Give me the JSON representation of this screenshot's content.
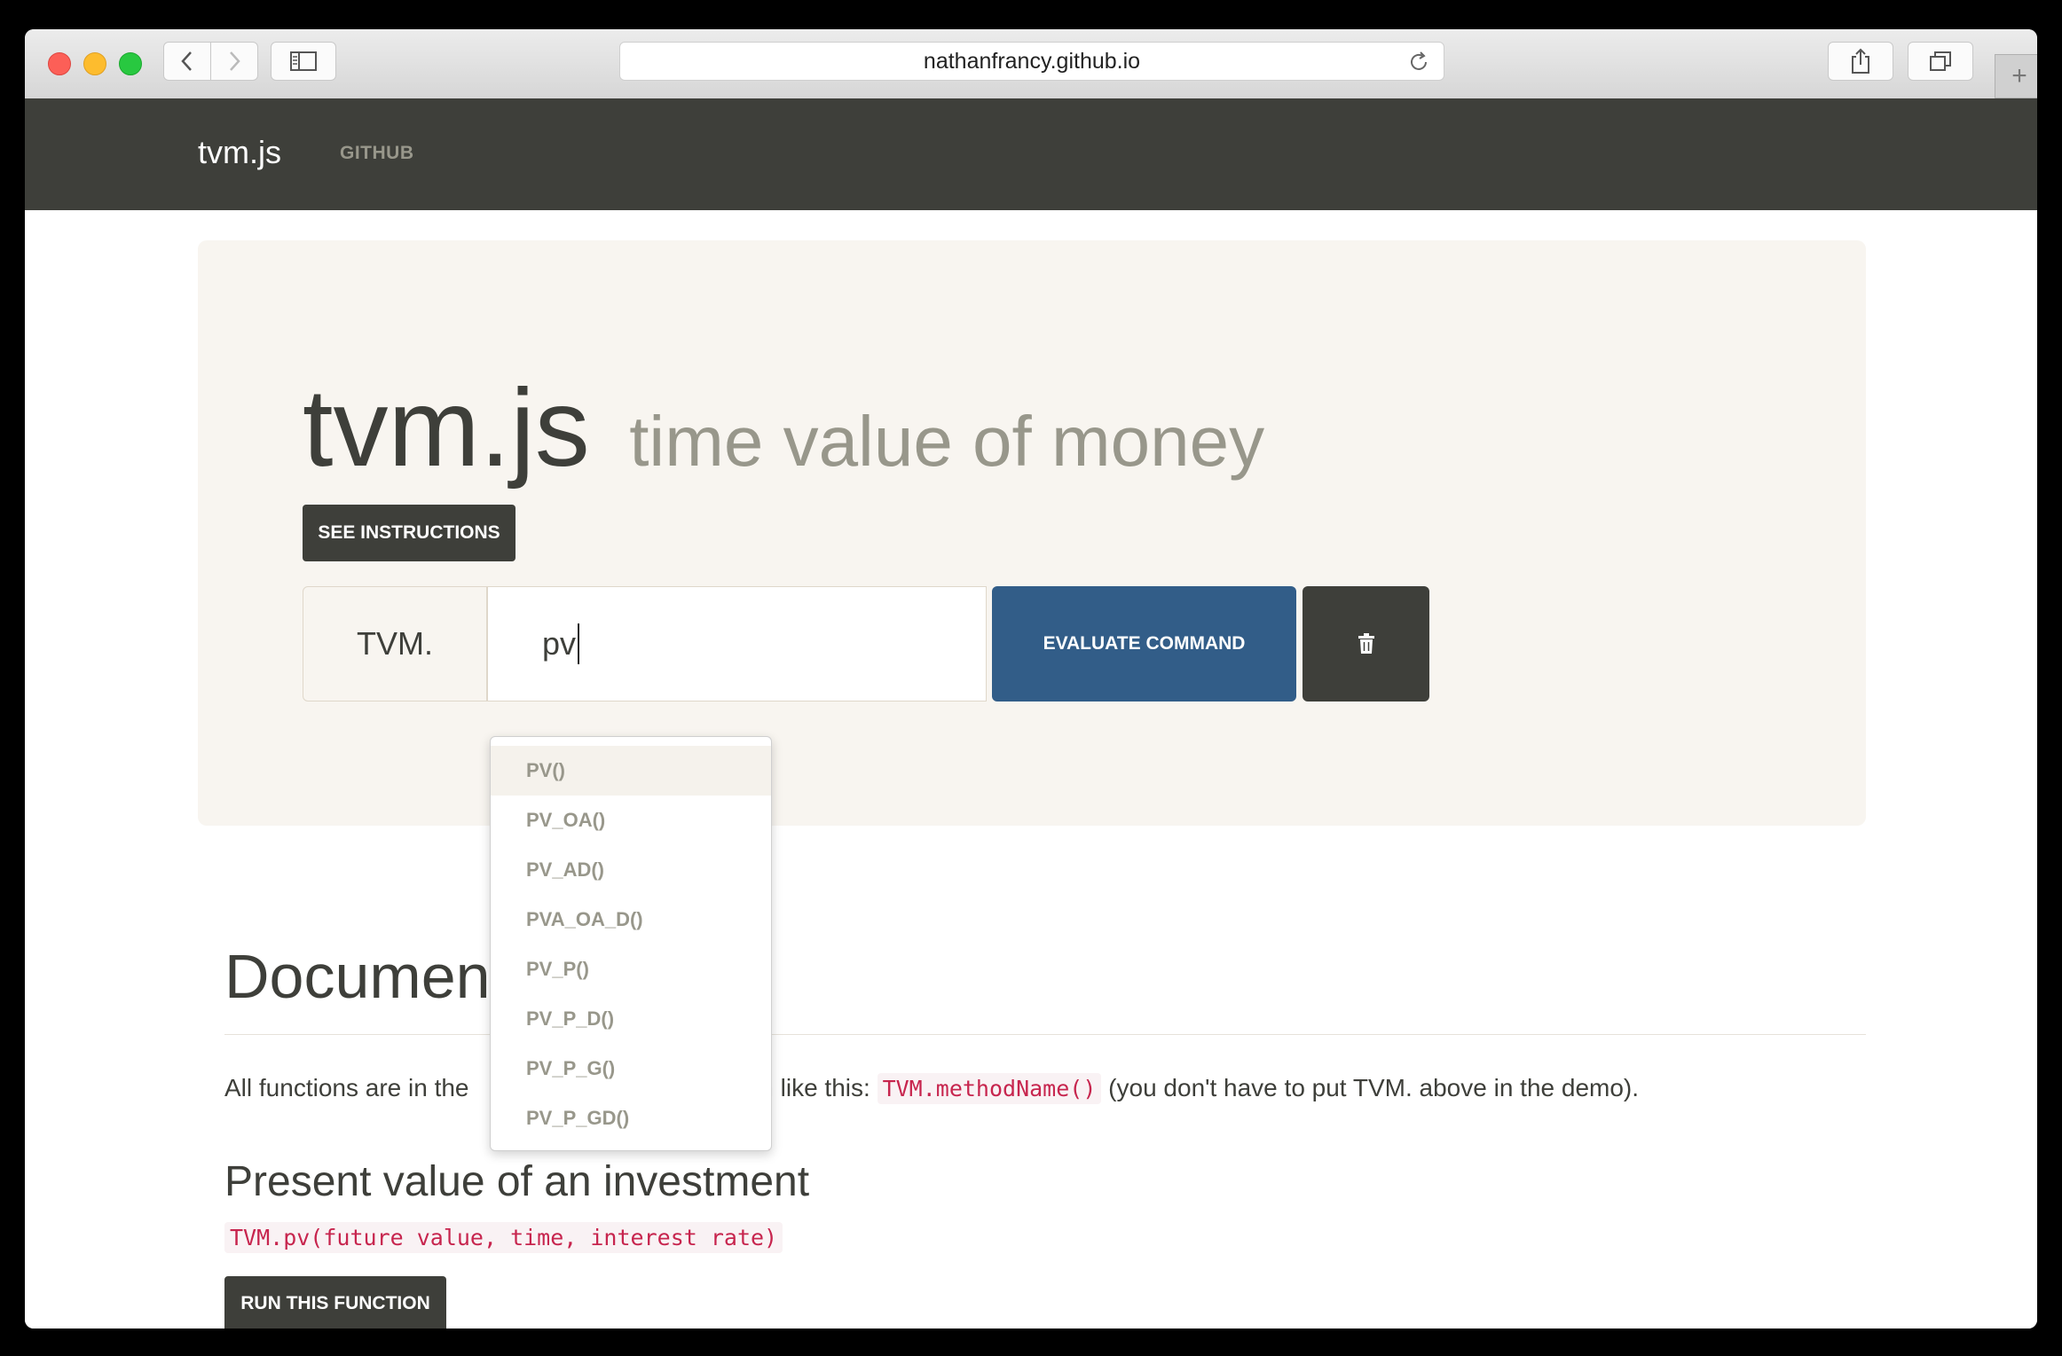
{
  "browser": {
    "url": "nathanfrancy.github.io"
  },
  "navbar": {
    "brand": "tvm.js",
    "github": "GITHUB"
  },
  "hero": {
    "title": "tvm.js",
    "subtitle": "time value of money",
    "instructions_button": "SEE INSTRUCTIONS"
  },
  "command": {
    "prefix": "TVM.",
    "value": "pv",
    "evaluate_button": "EVALUATE COMMAND"
  },
  "autocomplete": {
    "items": [
      "PV()",
      "PV_OA()",
      "PV_AD()",
      "PVA_OA_D()",
      "PV_P()",
      "PV_P_D()",
      "PV_P_G()",
      "PV_P_GD()"
    ]
  },
  "docs": {
    "heading": "Documen",
    "intro_before": "All functions are in the ",
    "intro_hidden": "",
    "intro_middle": "n like this: ",
    "intro_code": "TVM.methodName()",
    "intro_after": " (you don't have to put TVM. above in the demo).",
    "section_title": "Present value of an investment",
    "signature": "TVM.pv(future value, time, interest rate)",
    "run_button": "RUN THIS FUNCTION"
  }
}
